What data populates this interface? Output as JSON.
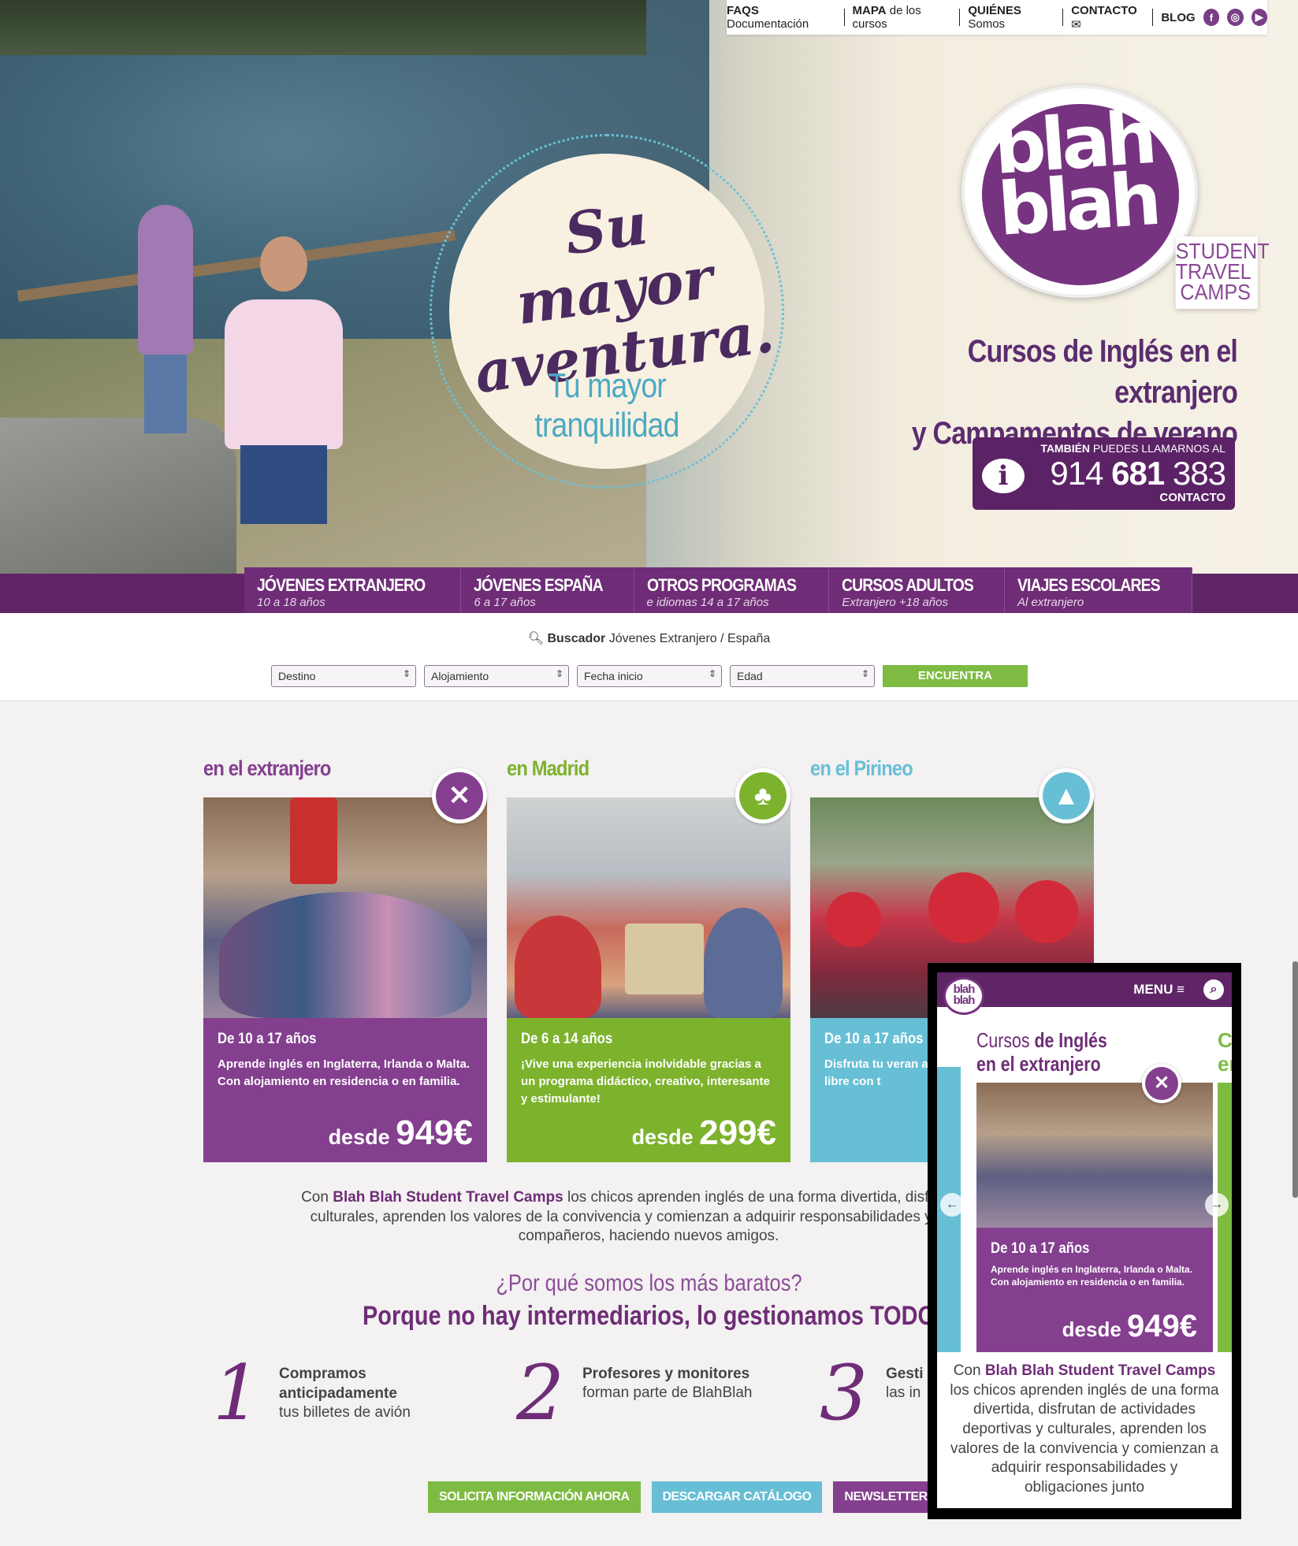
{
  "top_nav": {
    "items": [
      {
        "bold": "FAQS",
        "rest": " Documentación"
      },
      {
        "bold": "MAPA",
        "rest": " de los cursos"
      },
      {
        "bold": "QUIÉNES",
        "rest": " Somos"
      },
      {
        "bold": "CONTACTO",
        "rest": ""
      },
      {
        "bold": "BLOG",
        "rest": ""
      }
    ],
    "social": [
      "f",
      "◎",
      "▶"
    ]
  },
  "hero": {
    "slogan_line1": "Su mayor",
    "slogan_line2": "aventura.",
    "slogan_sub": "Tu mayor tranquilidad",
    "logo_text": "blah blah",
    "logo_tag": "STUDENT TRAVEL CAMPS",
    "headline_1": "Cursos de Inglés en el extranjero",
    "headline_2": "y Campamentos de verano",
    "phone_pre_bold": "TAMBIÉN",
    "phone_pre": " PUEDES LLAMARNOS AL",
    "phone_part1": "914 ",
    "phone_part2": "681",
    "phone_part3": " 383",
    "phone_contact": "CONTACTO"
  },
  "main_nav": {
    "tabs": [
      {
        "title": "JÓVENES EXTRANJERO",
        "sub": "10 a 18 años"
      },
      {
        "title": "JÓVENES ESPAÑA",
        "sub": "6 a 17 años"
      },
      {
        "title": "OTROS PROGRAMAS",
        "sub": "e idiomas 14 a 17 años"
      },
      {
        "title": "CURSOS ADULTOS",
        "sub": "Extranjero +18 años"
      },
      {
        "title": "VIAJES ESCOLARES",
        "sub": "Al extranjero"
      }
    ]
  },
  "search": {
    "title_bold": "Buscador",
    "title_rest": " Jóvenes Extranjero / España",
    "filters": [
      "Destino",
      "Alojamiento",
      "Fecha inicio",
      "Edad"
    ],
    "button": "ENCUENTRA"
  },
  "cards": [
    {
      "heading": "en el extranjero",
      "age": "De 10 a 17 años",
      "desc": "Aprende inglés en Inglaterra, Irlanda o Malta. Con alojamiento en residencia o en familia.",
      "price_prefix": "desde ",
      "price": "949€",
      "color": "#843f8f"
    },
    {
      "heading": "en Madrid",
      "age": "De 6 a 14 años",
      "desc": "¡Vive una experiencia inolvidable gracias a un programa didáctico, creativo, interesante y estimulante!",
      "price_prefix": "desde ",
      "price": "299€",
      "color": "#7db22d"
    },
    {
      "heading": "en el Pirineo",
      "age": "De 10 a 17 años",
      "desc": "Disfruta tu veran aprendiendo ingl al aire libre con t",
      "price_prefix": "",
      "price": "",
      "color": "#67bfd6"
    }
  ],
  "intro": {
    "pre": "Con ",
    "brand": "Blah Blah Student Travel Camps",
    "line1_rest": " los chicos aprenden inglés de una forma divertida, disfrutan de a",
    "line2": "culturales, aprenden los valores de la convivencia y comienzan a adquirir responsabilidades y obligaci",
    "line3": "compañeros, haciendo nuevos amigos."
  },
  "why": {
    "question": "¿Por qué somos los más baratos?",
    "answer": "Porque no hay intermediarios, lo gestionamos TODO"
  },
  "steps": [
    {
      "num": "1",
      "bold": "Compramos anticipadamente",
      "rest": "tus billetes de avión"
    },
    {
      "num": "2",
      "bold": "Profesores y monitores",
      "rest": "forman parte de BlahBlah"
    },
    {
      "num": "3",
      "bold": "Gesti",
      "rest": "las in"
    }
  ],
  "ctas": [
    {
      "label": "SOLICITA INFORMACIÓN AHORA",
      "color": "#7dbb42"
    },
    {
      "label": "DESCARGAR CATÁLOGO",
      "color": "#67bfd6"
    },
    {
      "label": "NEWSLETTER",
      "color": "#843f8f"
    }
  ],
  "mobile": {
    "logo": "blah blah",
    "menu": "MENU ≡",
    "heading_light": "Cursos ",
    "heading_bold": "de Inglés",
    "heading_line2": "en el extranjero",
    "next_peek": "Ca en",
    "age": "De 10 a 17 años",
    "desc": "Aprende inglés en Inglaterra, Irlanda o Malta. Con alojamiento en residencia o en familia.",
    "price_prefix": "desde ",
    "price": "949€",
    "text_pre": "Con ",
    "text_brand": "Blah Blah Student Travel Camps",
    "text_rest": " los chicos aprenden inglés de una forma divertida, disfrutan de actividades deportivas y culturales, aprenden los valores de la convivencia y comienzan a adquirir responsabilidades y obligaciones junto"
  }
}
